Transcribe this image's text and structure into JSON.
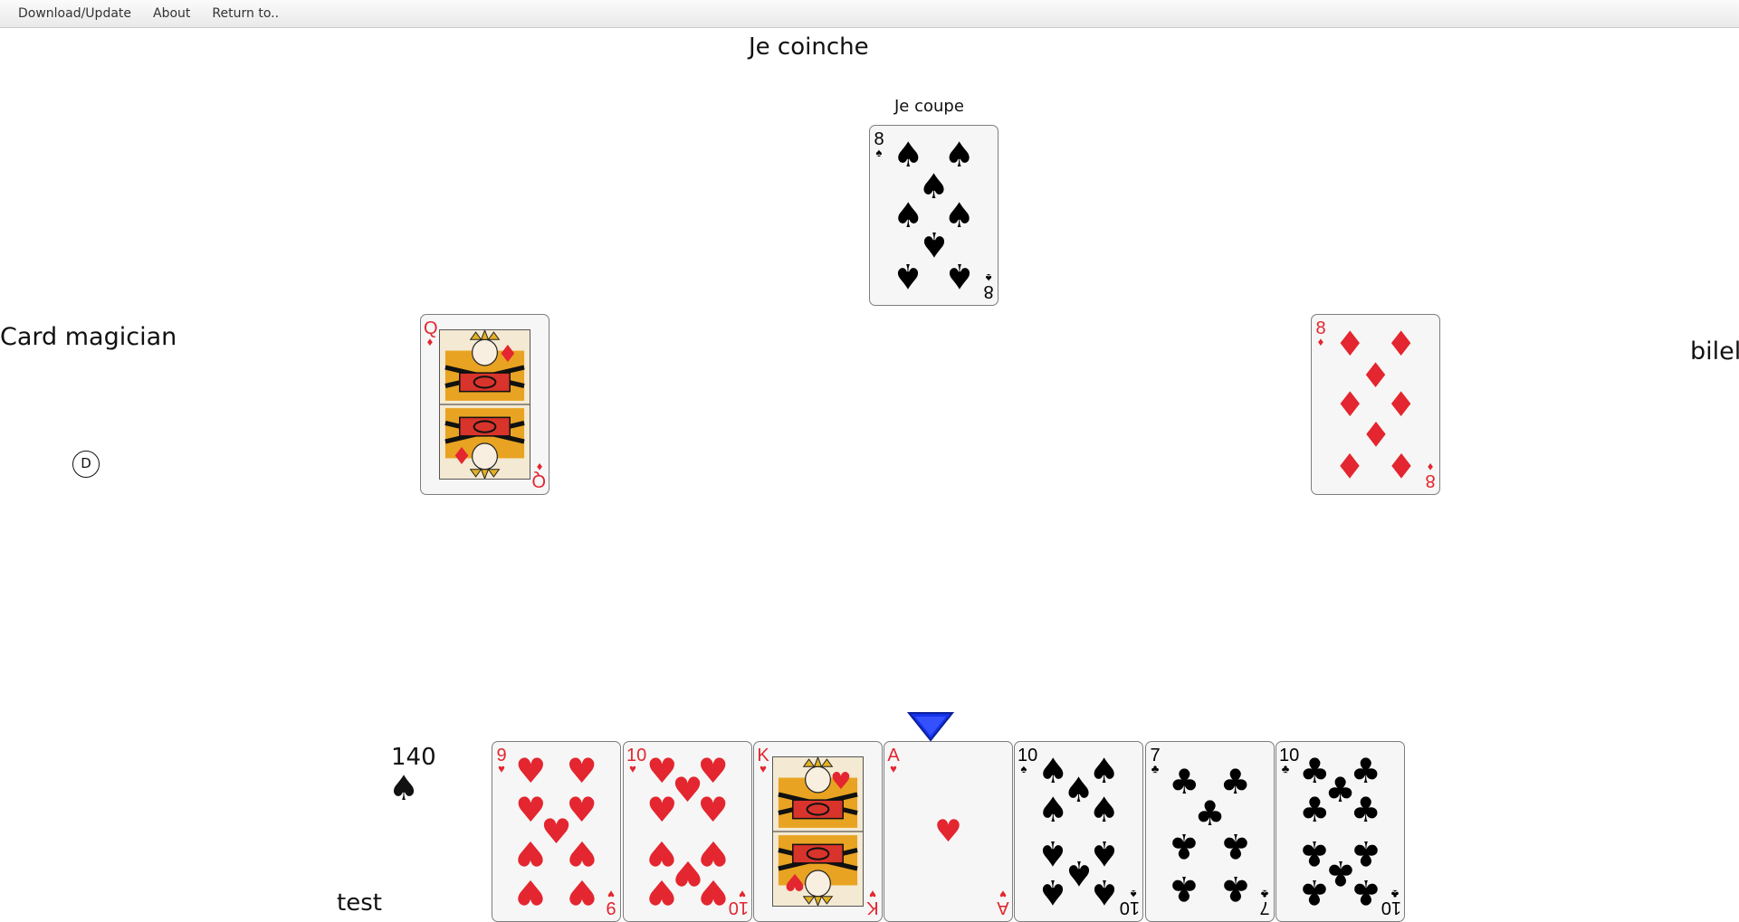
{
  "menu": {
    "items": [
      "Download/Update",
      "About",
      "Return to.."
    ]
  },
  "table": {
    "announcement_top": "Je coinche",
    "player_top_bid": "Je coupe",
    "player_left_name": "Card magician",
    "player_right_name": "bilel",
    "player_bottom_name": "test",
    "dealer_marker": "D",
    "bid": {
      "value": "140",
      "trump_symbol": "♠"
    }
  },
  "colors": {
    "red_suit": "#e3262f",
    "black_suit": "#000000",
    "turn_indicator": "#1433e8"
  },
  "played_cards": {
    "top": {
      "rank": "8",
      "suit": "♠",
      "color": "black"
    },
    "left": {
      "rank": "Q",
      "suit": "♦",
      "color": "red"
    },
    "right": {
      "rank": "8",
      "suit": "♦",
      "color": "red"
    }
  },
  "hand": [
    {
      "rank": "9",
      "suit": "♥",
      "color": "red"
    },
    {
      "rank": "10",
      "suit": "♥",
      "color": "red"
    },
    {
      "rank": "K",
      "suit": "♥",
      "color": "red"
    },
    {
      "rank": "A",
      "suit": "♥",
      "color": "red"
    },
    {
      "rank": "10",
      "suit": "♠",
      "color": "black"
    },
    {
      "rank": "7",
      "suit": "♣",
      "color": "black"
    },
    {
      "rank": "10",
      "suit": "♣",
      "color": "black"
    }
  ],
  "icons": {
    "turn_indicator": "triangle-down-icon"
  }
}
